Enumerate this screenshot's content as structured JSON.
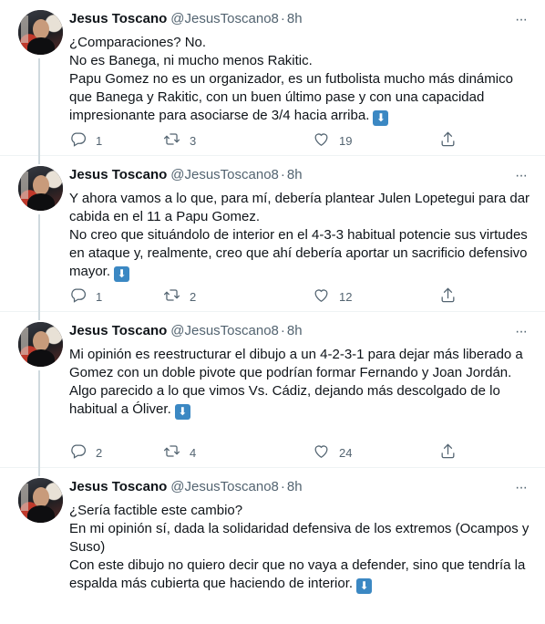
{
  "tweets": [
    {
      "name": "Jesus Toscano",
      "handle": "@JesusToscano8",
      "time": "8h",
      "lines": [
        "¿Comparaciones? No.",
        "No es Banega, ni mucho menos Rakitic.",
        "Papu Gomez no es un organizador, es un futbolista mucho más dinámico",
        "que Banega y Rakitic, con un buen último pase y con una capacidad",
        "impresionante para asociarse de 3/4 hacia arriba."
      ],
      "replies": "1",
      "retweets": "3",
      "likes": "19"
    },
    {
      "name": "Jesus Toscano",
      "handle": "@JesusToscano8",
      "time": "8h",
      "lines": [
        "Y ahora vamos a lo que, para mí, debería plantear Julen Lopetegui para dar",
        "cabida en el 11 a Papu Gomez.",
        "No creo que situándolo de interior en el 4-3-3 habitual potencie sus virtudes",
        "en ataque y, realmente, creo que ahí debería aportar un sacrificio defensivo",
        "mayor."
      ],
      "replies": "1",
      "retweets": "2",
      "likes": "12"
    },
    {
      "name": "Jesus Toscano",
      "handle": "@JesusToscano8",
      "time": "8h",
      "lines": [
        "Mi opinión es reestructurar el dibujo a un 4-2-3-1 para dejar más liberado a",
        "Gomez con un doble pivote que podrían formar Fernando y Joan Jordán.",
        "Algo parecido a lo que vimos Vs. Cádiz, dejando más descolgado de lo",
        "habitual a Óliver."
      ],
      "replies": "2",
      "retweets": "4",
      "likes": "24"
    },
    {
      "name": "Jesus Toscano",
      "handle": "@JesusToscano8",
      "time": "8h",
      "lines": [
        "¿Sería factible este cambio?",
        "En mi opinión sí, dada la solidaridad defensiva de los extremos (Ocampos y",
        "Suso)",
        "Con este dibujo no quiero decir que no vaya a defender, sino que tendría la",
        "espalda más cubierta que haciendo de interior."
      ]
    }
  ],
  "emoji": "⬇",
  "icons": {
    "reply": "reply-icon",
    "retweet": "retweet-icon",
    "like": "like-icon",
    "share": "share-icon",
    "more": "more-options-icon",
    "emoji": "down-arrow-emoji-icon"
  },
  "colors": {
    "text": "#0f1419",
    "secondary": "#536471",
    "thread_line": "#cfd9de",
    "divider": "#eff3f4",
    "emoji_bg": "#3b88c3"
  }
}
